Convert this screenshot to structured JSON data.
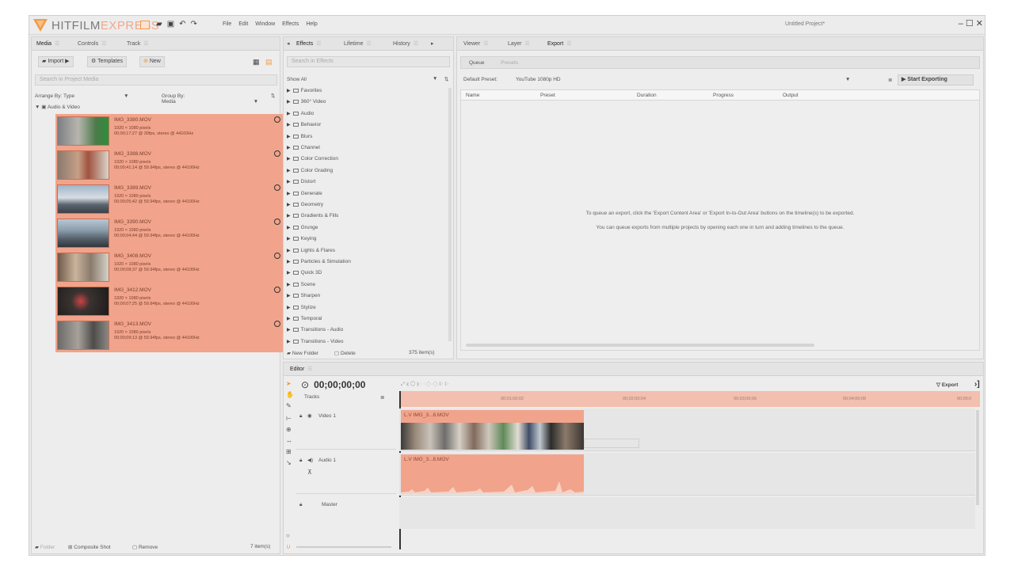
{
  "app": {
    "brand_part1": "HITFILM",
    "brand_part2": "EXPRESS",
    "menus": [
      "File",
      "Edit",
      "Window",
      "Effects",
      "Help"
    ],
    "project_title": "Untitled Project*",
    "window_controls": "– ☐ ✕"
  },
  "media_panel": {
    "tabs": [
      "Media",
      "Controls",
      "Track"
    ],
    "import_label": "Import",
    "templates_label": "Templates",
    "new_label": "New",
    "search_placeholder": "Search in Project Media",
    "arrange_label": "Arrange By: Type",
    "group_label": "Group By: Media",
    "folder_label": "Audio & Video",
    "items": [
      {
        "name": "IMG_3380.MOV",
        "res": "1920 × 1080 pixels",
        "info": "00;00;17;27 @ 30fps, stereo @ 44100Hz"
      },
      {
        "name": "IMG_3388.MOV",
        "res": "1920 × 1080 pixels",
        "info": "00;00;41;14 @ 59.94fps, stereo @ 44100Hz"
      },
      {
        "name": "IMG_3389.MOV",
        "res": "1920 × 1080 pixels",
        "info": "00;00;05;42 @ 59.94fps, stereo @ 44100Hz"
      },
      {
        "name": "IMG_3390.MOV",
        "res": "1920 × 1080 pixels",
        "info": "00;00;04;44 @ 59.94fps, stereo @ 44100Hz"
      },
      {
        "name": "IMG_3408.MOV",
        "res": "1920 × 1080 pixels",
        "info": "00;00;08;37 @ 59.94fps, stereo @ 44100Hz"
      },
      {
        "name": "IMG_3412.MOV",
        "res": "1920 × 1080 pixels",
        "info": "00;00;07;25 @ 59.94fps, stereo @ 44100Hz"
      },
      {
        "name": "IMG_3413.MOV",
        "res": "1920 × 1080 pixels",
        "info": "00;00;09;13 @ 59.94fps, stereo @ 44100Hz"
      }
    ],
    "footer_folder": "Folder",
    "footer_composite": "Composite Shot",
    "footer_remove": "Remove",
    "footer_count": "7 item(s)"
  },
  "effects_panel": {
    "tabs": [
      "Effects",
      "Lifetime",
      "History"
    ],
    "search_placeholder": "Search in Effects",
    "show_label": "Show All",
    "categories": [
      "Favorites",
      "360° Video",
      "Audio",
      "Behavior",
      "Blurs",
      "Channel",
      "Color Correction",
      "Color Grading",
      "Distort",
      "Generate",
      "Geometry",
      "Gradients & Fills",
      "Grunge",
      "Keying",
      "Lights & Flares",
      "Particles & Simulation",
      "Quick 3D",
      "Scene",
      "Sharpen",
      "Stylize",
      "Temporal",
      "Transitions - Audio",
      "Transitions - Video"
    ],
    "new_folder": "New Folder",
    "delete": "Delete",
    "count": "375 item(s)"
  },
  "export_panel": {
    "tabs": [
      "Viewer",
      "Layer",
      "Export"
    ],
    "subtabs": [
      "Queue",
      "Presets"
    ],
    "default_preset_label": "Default Preset:",
    "default_preset_value": "YouTube 1080p HD",
    "start_exporting": "Start Exporting",
    "columns": [
      "Name",
      "Preset",
      "Duration",
      "Progress",
      "Output"
    ],
    "message1": "To queue an export, click the 'Export Content Area' or 'Export In-to-Out Area' buttons on the timeline(s) to be exported.",
    "message2": "You can queue exports from multiple projects by opening each one in turn and adding timelines to the queue."
  },
  "editor": {
    "tab": "Editor",
    "timecode": "00;00;00;00",
    "export_label": "Export",
    "tracks_label": "Tracks",
    "video_track": "Video 1",
    "audio_track": "Audio 1",
    "master_track": "Master",
    "ruler": [
      "00;01;00;02",
      "00;02;00;04",
      "00;03;00;06",
      "00;04;00;08",
      "00;05;0"
    ],
    "video_clip_label": "L.V   IMG_3...8.MOV",
    "audio_clip_label": "L.V   IMG_3...8.MOV"
  },
  "colors": {
    "accent": "#f1a48b",
    "accent_dark": "#e27d5e",
    "brand_orange": "#f39a45",
    "panel_bg": "#ededed"
  }
}
